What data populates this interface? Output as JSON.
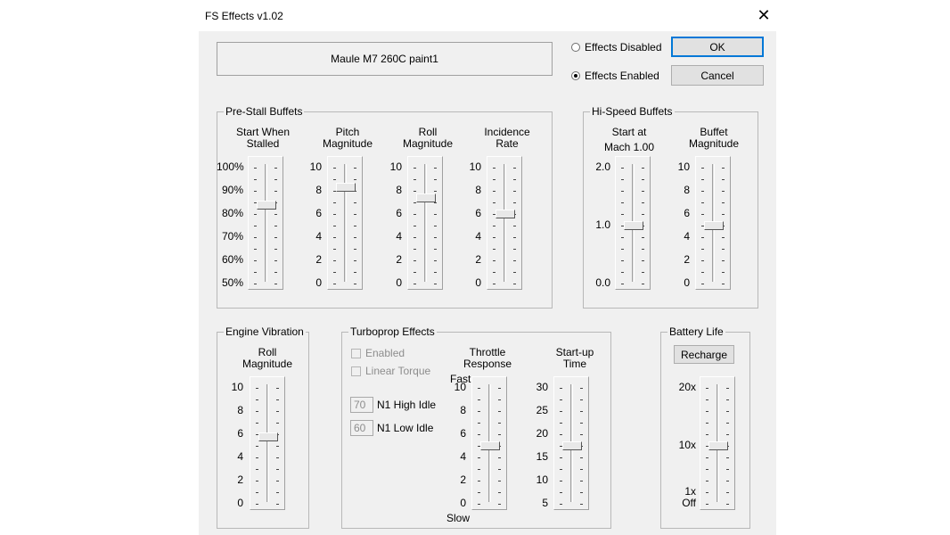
{
  "window": {
    "title": "FS Effects v1.02",
    "close_glyph": "✕"
  },
  "aircraft": {
    "name": "Maule M7 260C paint1"
  },
  "mode": {
    "disabled_label": "Effects Disabled",
    "enabled_label": "Effects Enabled",
    "selected": "enabled"
  },
  "buttons": {
    "ok": "OK",
    "cancel": "Cancel",
    "recharge": "Recharge"
  },
  "prestall": {
    "title": "Pre-Stall Buffets",
    "start_when_stalled": {
      "label1": "Start When",
      "label2": "Stalled",
      "ticks": [
        "100%",
        "90%",
        "80%",
        "70%",
        "60%",
        "50%"
      ],
      "value_fraction": 0.68
    },
    "pitch_magnitude": {
      "label1": "Pitch",
      "label2": "Magnitude",
      "ticks": [
        "10",
        "8",
        "6",
        "4",
        "2",
        "0"
      ],
      "value_fraction": 0.83
    },
    "roll_magnitude": {
      "label1": "Roll",
      "label2": "Magnitude",
      "ticks": [
        "10",
        "8",
        "6",
        "4",
        "2",
        "0"
      ],
      "value_fraction": 0.74
    },
    "incidence_rate": {
      "label1": "Incidence",
      "label2": "Rate",
      "ticks": [
        "10",
        "8",
        "6",
        "4",
        "2",
        "0"
      ],
      "value_fraction": 0.6
    }
  },
  "hispeed": {
    "title": "Hi-Speed Buffets",
    "start_at": {
      "label1": "Start at",
      "label2": "Mach  1.00",
      "ticks": [
        "2.0",
        "1.0",
        "0.0"
      ],
      "value_fraction": 0.5
    },
    "buffet_magnitude": {
      "label1": "Buffet",
      "label2": "Magnitude",
      "ticks": [
        "10",
        "8",
        "6",
        "4",
        "2",
        "0"
      ],
      "value_fraction": 0.5
    }
  },
  "engine": {
    "title": "Engine Vibration",
    "roll_magnitude": {
      "label1": "Roll",
      "label2": "Magnitude",
      "ticks": [
        "10",
        "8",
        "6",
        "4",
        "2",
        "0"
      ],
      "value_fraction": 0.58
    }
  },
  "turboprop": {
    "title": "Turboprop Effects",
    "enabled_label": "Enabled",
    "linear_torque_label": "Linear Torque",
    "n1_high_value": "70",
    "n1_high_label": "N1 High Idle",
    "n1_low_value": "60",
    "n1_low_label": "N1 Low Idle",
    "throttle_response": {
      "label1": "Throttle",
      "label2": "Response",
      "fast": "Fast",
      "slow": "Slow",
      "ticks": [
        "10",
        "8",
        "6",
        "4",
        "2",
        "0"
      ],
      "value_fraction": 0.5
    },
    "startup_time": {
      "label1": "Start-up",
      "label2": "Time",
      "ticks": [
        "30",
        "25",
        "20",
        "15",
        "10",
        "5"
      ],
      "value_fraction": 0.5
    }
  },
  "battery": {
    "title": "Battery Life",
    "ticks": [
      "20x",
      "10x",
      "1x",
      "Off"
    ],
    "value_fraction": 0.5
  }
}
